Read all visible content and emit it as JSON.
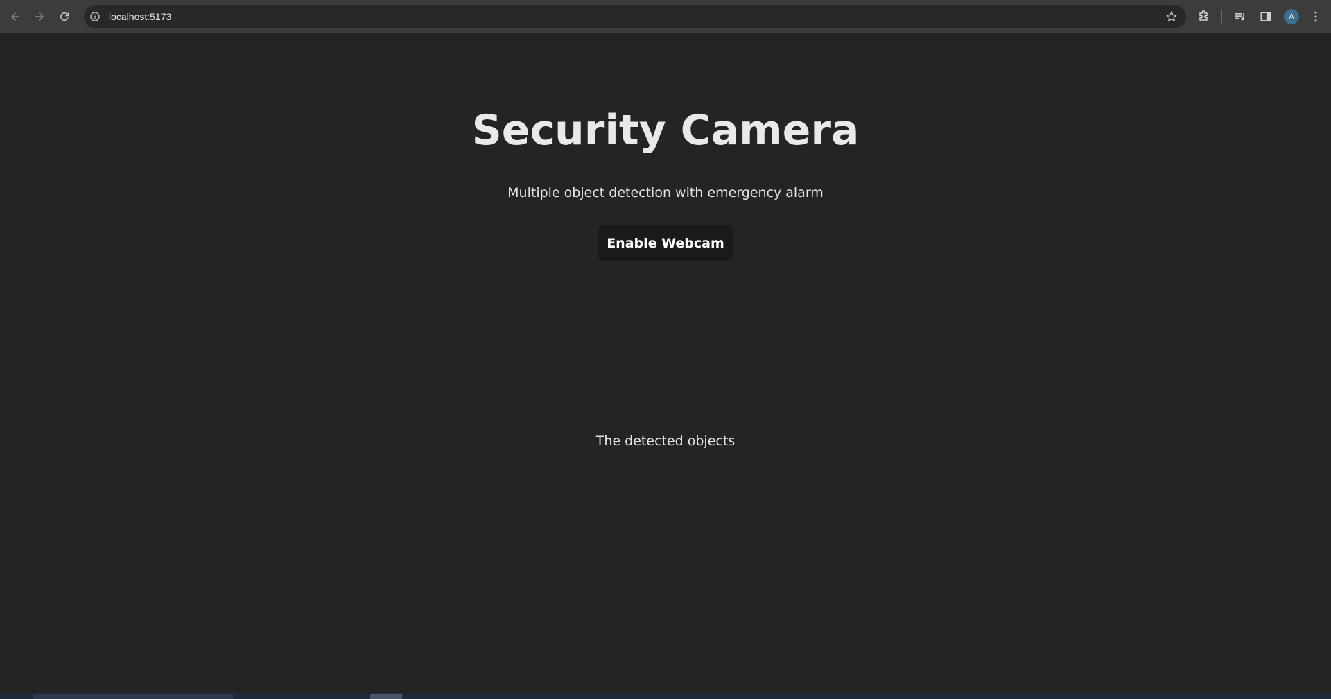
{
  "browser": {
    "url": "localhost:5173",
    "profile_initial": "A",
    "icons": {
      "back": "arrow-left-icon",
      "forward": "arrow-right-icon",
      "reload": "reload-icon",
      "site_info": "info-icon",
      "bookmark": "star-icon",
      "extensions": "puzzle-icon",
      "media": "media-queue-icon",
      "side_panel": "side-panel-icon",
      "menu": "kebab-menu-icon"
    }
  },
  "page": {
    "title": "Security Camera",
    "subtitle": "Multiple object detection with emergency alarm",
    "enable_button_label": "Enable Webcam",
    "detected_label": "The detected objects"
  },
  "colors": {
    "background": "#242424",
    "toolbar": "#3c3c3c",
    "button_bg": "#1a1a1a",
    "text": "#e9e9e9"
  }
}
